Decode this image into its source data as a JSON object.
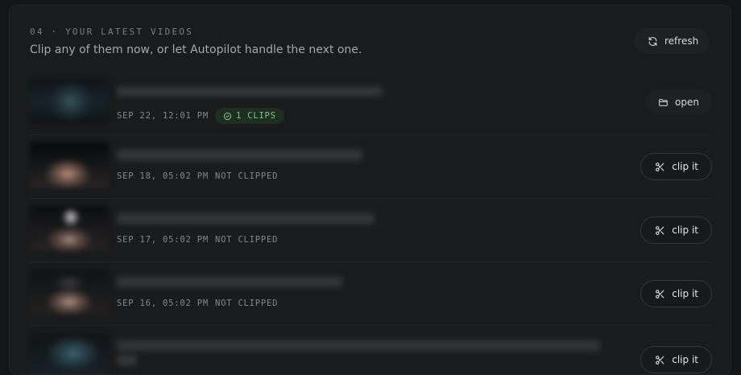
{
  "section": {
    "label": "04 · YOUR LATEST VIDEOS",
    "subtitle": "Clip any of them now, or let Autopilot handle the next one.",
    "refresh_label": "refresh"
  },
  "videos": [
    {
      "date": "SEP 22, 12:01 PM",
      "status": "1 CLIPS",
      "clipped": true,
      "action_label": "open"
    },
    {
      "date": "SEP 18, 05:02 PM",
      "status": "NOT CLIPPED",
      "clipped": false,
      "action_label": "clip it"
    },
    {
      "date": "SEP 17, 05:02 PM",
      "status": "NOT CLIPPED",
      "clipped": false,
      "action_label": "clip it"
    },
    {
      "date": "SEP 16, 05:02 PM",
      "status": "NOT CLIPPED",
      "clipped": false,
      "action_label": "clip it"
    },
    {
      "date": "",
      "status": "",
      "clipped": false,
      "action_label": "clip it"
    }
  ],
  "colors": {
    "clipped_badge_bg": "#1e2f22",
    "clipped_badge_text": "#7dc18c"
  }
}
